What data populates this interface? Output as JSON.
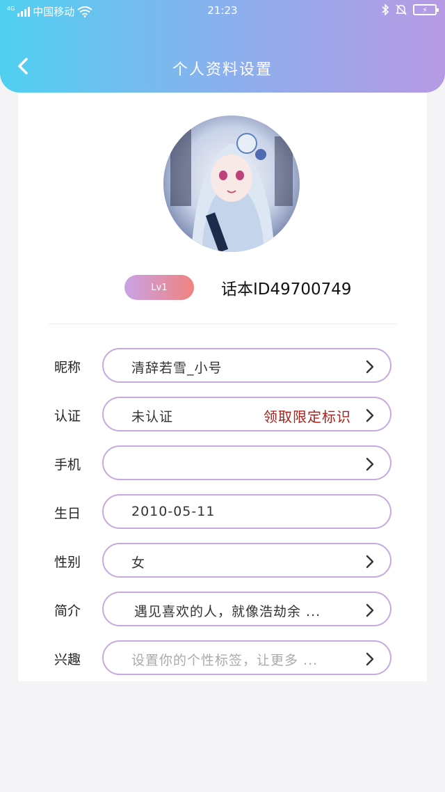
{
  "status_bar": {
    "network": "4G",
    "carrier": "中国移动",
    "time": "21:23",
    "battery_icon": "battery-charging-icon"
  },
  "header": {
    "title": "个人资料设置",
    "back_icon": "chevron-left-icon"
  },
  "profile": {
    "level_badge": "Lv1",
    "id_text": "话本ID49700749"
  },
  "fields": [
    {
      "label": "昵称",
      "value": "清辞若雪_小号"
    },
    {
      "label": "认证",
      "value": "未认证",
      "action": "领取限定标识"
    },
    {
      "label": "手机",
      "value": ""
    },
    {
      "label": "生日",
      "value": "2010-05-11"
    },
    {
      "label": "性别",
      "value": "女"
    },
    {
      "label": "简介",
      "value": "遇见喜欢的人，就像浩劫余 ..."
    },
    {
      "label": "兴趣",
      "placeholder": "设置你的个性标签，让更多 ..."
    }
  ],
  "colors": {
    "header_gradient_start": "#4fd0f0",
    "header_gradient_end": "#b79ae4",
    "pill_border": "#c5a9e0",
    "action_text": "#a2231f"
  }
}
